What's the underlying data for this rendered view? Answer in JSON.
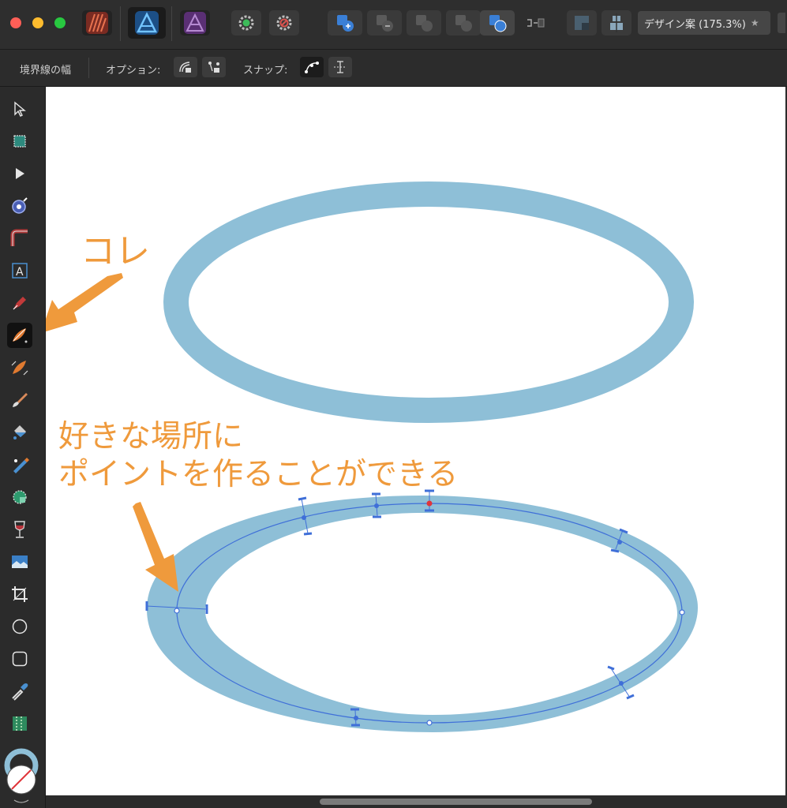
{
  "window": {
    "traffic_lights": [
      "#ff5f57",
      "#febc2e",
      "#28c840"
    ],
    "document_tab": "デザイン案 (175.3%)",
    "document_tab_star": "★"
  },
  "context_toolbar": {
    "stroke_width_label": "境界線の幅",
    "options_label": "オプション:",
    "snap_label": "スナップ:"
  },
  "annotations": {
    "this_label": "コレ",
    "caption_line1": "好きな場所に",
    "caption_line2": "ポイントを作ることができる",
    "accent_color": "#ef9a3c"
  },
  "canvas": {
    "stroke_color": "#8ebfd7",
    "curve_color": "#3f6fd8"
  },
  "tools": [
    "move-tool",
    "artboard-tool",
    "node-tool",
    "corner-tool",
    "point-transform-tool",
    "artistic-text-tool",
    "pen-tool",
    "width-pen-tool",
    "width-tool",
    "pencil-tool",
    "fill-tool",
    "transparency-tool",
    "shape-builder-tool",
    "wine-glass-tool",
    "image-tool",
    "crop-tool",
    "ellipse-tool",
    "rounded-rect-tool",
    "color-picker-tool",
    "gradient-tool",
    "fill-stroke-well"
  ]
}
